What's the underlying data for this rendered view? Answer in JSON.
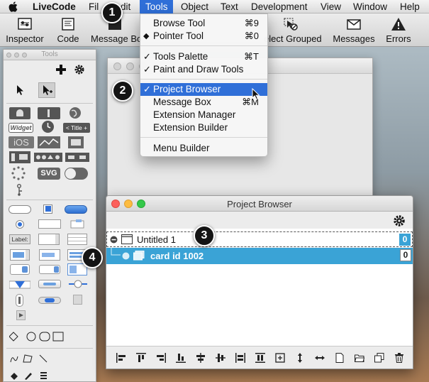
{
  "menubar": {
    "app_name": "LiveCode",
    "items": [
      "File",
      "Edit",
      "Tools",
      "Object",
      "Text",
      "Development",
      "View",
      "Window",
      "Help"
    ],
    "file_visible": "Fil",
    "edit_visible": "dit"
  },
  "toolbar": {
    "inspector": "Inspector",
    "code": "Code",
    "message_box": "Message Bo",
    "select_grouped": "elect Grouped",
    "messages": "Messages",
    "errors": "Errors"
  },
  "tools_palette": {
    "title": "Tools",
    "widget_label": "Widget",
    "title_widget_label": "< Title +",
    "ios_label": "iOS",
    "svg_label": "SVG",
    "label_field_text": "Label:"
  },
  "tools_menu": {
    "items": [
      {
        "label": "Browse Tool",
        "shortcut": "⌘9",
        "mark": ""
      },
      {
        "label": "Pointer Tool",
        "shortcut": "⌘0",
        "mark": "◆"
      },
      {
        "label": "Tools Palette",
        "shortcut": "⌘T",
        "mark": "✓"
      },
      {
        "label": "Paint and Draw Tools",
        "shortcut": "",
        "mark": "✓"
      },
      {
        "label": "Project Browser",
        "shortcut": "",
        "mark": "✓"
      },
      {
        "label": "Message Box",
        "shortcut": "⌘M",
        "mark": ""
      },
      {
        "label": "Extension Manager",
        "shortcut": "",
        "mark": ""
      },
      {
        "label": "Extension Builder",
        "shortcut": "",
        "mark": ""
      },
      {
        "label": "Menu Builder",
        "shortcut": "",
        "mark": ""
      }
    ]
  },
  "project_browser": {
    "title": "Project Browser",
    "stack_row": {
      "name": "Untitled 1",
      "count": "0"
    },
    "card_row": {
      "name": "card id 1002",
      "count": "0"
    }
  },
  "callouts": [
    "1",
    "2",
    "3",
    "4"
  ],
  "colors": {
    "menu_highlight": "#2f6fd8",
    "selected_row": "#3aa3d6",
    "close": "#fc605c",
    "minimize": "#fdbc40",
    "zoom": "#34c84a"
  }
}
